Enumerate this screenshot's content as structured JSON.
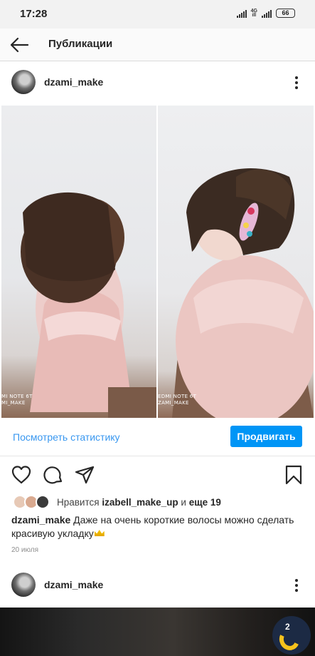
{
  "status_bar": {
    "time": "17:28",
    "network_label_top": "4G",
    "network_label_bottom": "ill",
    "battery": "66"
  },
  "header": {
    "title": "Публикации",
    "back_icon": "arrow-left-icon"
  },
  "post": {
    "username": "dzami_make",
    "more_icon": "more-vertical-icon",
    "photos": [
      {
        "watermark_line1": "MI NOTE 6T",
        "watermark_line2": "MI_MAKE"
      },
      {
        "watermark_line1": "EDMI NOTE 6T",
        "watermark_line2": "ZAMI_MAKE"
      }
    ],
    "stats_link": "Посмотреть статистику",
    "promote_button": "Продвигать",
    "actions": [
      "heart-icon",
      "comment-icon",
      "share-icon",
      "bookmark-icon"
    ],
    "likes": {
      "prefix": "Нравится",
      "user": "izabell_make_up",
      "connector": "и",
      "others": "еще 19"
    },
    "caption_username": "dzami_make",
    "caption_text": "Даже на очень короткие волосы можно сделать красивую укладку",
    "date": "20 июля"
  },
  "next_post": {
    "username": "dzami_make",
    "more_icon": "more-vertical-icon"
  },
  "floating_button": {
    "badge": "2"
  },
  "colors": {
    "link": "#3897f0",
    "primary_button": "#0095f6",
    "text": "#262626",
    "muted": "#8e8e8e",
    "dress_pink": "#ebc1bd",
    "hair_brown": "#3b2b22"
  }
}
